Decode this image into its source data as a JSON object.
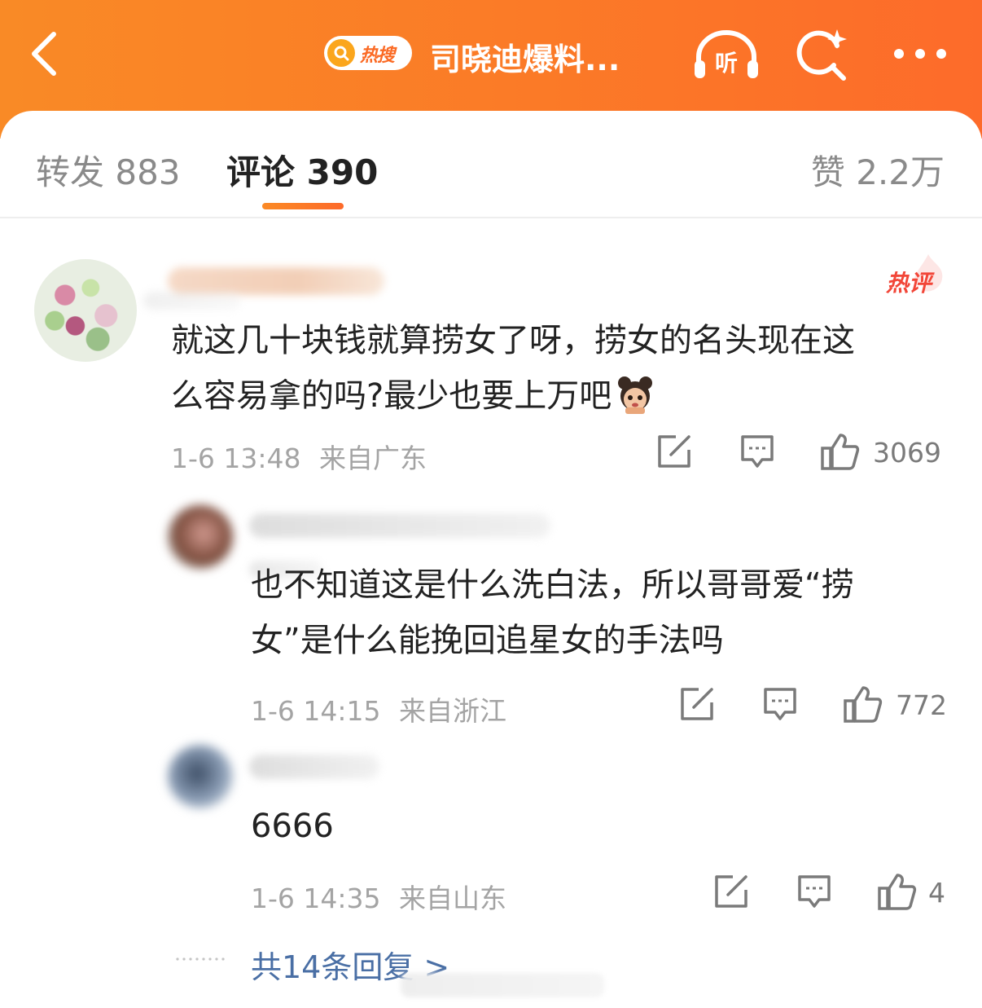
{
  "header": {
    "hot_badge_label": "热搜",
    "title": "司晓迪爆料...",
    "listen_label": "听",
    "colors": {
      "gradient_start": "#f98a26",
      "gradient_end": "#fd6b2a"
    }
  },
  "tabs": {
    "repost": "转发 883",
    "comment": "评论 390",
    "like": "赞 2.2万"
  },
  "comments": [
    {
      "hot_tag": "热评",
      "text_line1": "就这几十块钱就算捞女了呀，捞女的名头现在这",
      "text_line2": "么容易拿的吗?最少也要上万吧",
      "time": "1-6 13:48",
      "location": "来自广东",
      "likes": "3069"
    }
  ],
  "replies": [
    {
      "text_line1": "也不知道这是什么洗白法，所以哥哥爱“捞",
      "text_line2": "女”是什么能挽回追星女的手法吗",
      "time": "1-6 14:15",
      "location": "来自浙江",
      "likes": "772"
    },
    {
      "text_line1": "6666",
      "time": "1-6 14:35",
      "location": "来自山东",
      "likes": "4"
    }
  ],
  "more_replies": "共14条回复 >"
}
